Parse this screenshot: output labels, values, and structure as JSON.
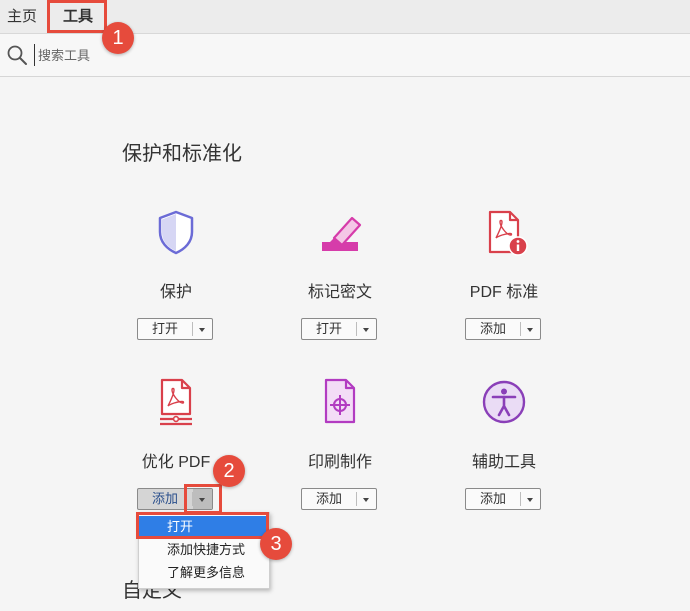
{
  "tabs": [
    {
      "label": "主页"
    },
    {
      "label": "工具"
    }
  ],
  "search": {
    "placeholder": "搜索工具"
  },
  "section": {
    "title": "保护和标准化"
  },
  "tools": [
    {
      "name": "保护",
      "button": "打开",
      "icon": "shield-icon"
    },
    {
      "name": "标记密文",
      "button": "打开",
      "icon": "redact-marker-icon"
    },
    {
      "name": "PDF 标准",
      "button": "添加",
      "icon": "pdf-standards-icon"
    },
    {
      "name": "优化 PDF",
      "button": "添加",
      "icon": "optimize-pdf-icon"
    },
    {
      "name": "印刷制作",
      "button": "添加",
      "icon": "print-production-icon"
    },
    {
      "name": "辅助工具",
      "button": "添加",
      "icon": "accessibility-icon"
    }
  ],
  "dropdown_menu": {
    "items": [
      {
        "label": "打开",
        "selected": true
      },
      {
        "label": "添加快捷方式"
      },
      {
        "label": "了解更多信息"
      }
    ]
  },
  "next_section": {
    "title": "自定义"
  },
  "annotations": [
    {
      "number": "1"
    },
    {
      "number": "2"
    },
    {
      "number": "3"
    }
  ],
  "colors": {
    "shield": "#6b6bd6",
    "redact": "#d63caa",
    "pdf_red": "#d9404b",
    "print_purple": "#b23bc1",
    "accessibility": "#8a3fb8",
    "menu_selected": "#2f7ee6",
    "annotation": "#e64b3c"
  }
}
